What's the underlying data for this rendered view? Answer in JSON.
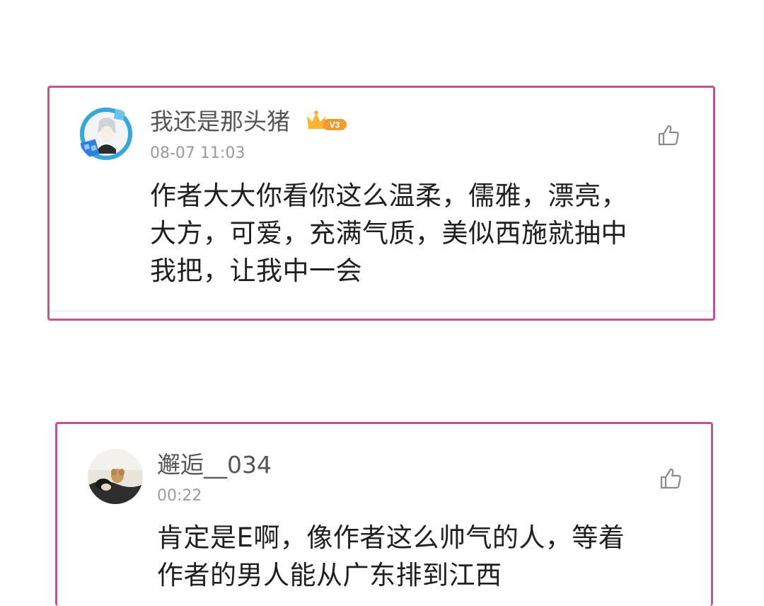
{
  "comments": [
    {
      "username": "我还是那头猪",
      "level_badge": "V3",
      "time": "08-07 11:03",
      "content_lines": [
        "作者大大你看你这么温柔，儒雅，漂亮，",
        "大方，可爱，充满气质，美似西施就抽中",
        "我把，让我中一会"
      ],
      "avatar_icon": "anime-character-avatar-icon",
      "like_icon": "thumbs-up-icon"
    },
    {
      "username": "邂逅__034",
      "time": "00:22",
      "content_lines": [
        "肯定是E啊，像作者这么帅气的人，等着",
        "作者的男人能从广东排到江西"
      ],
      "avatar_icon": "photo-avatar-icon",
      "like_icon": "thumbs-up-icon"
    }
  ],
  "colors": {
    "highlight_border": "#c0548f",
    "username": "#555555",
    "timestamp": "#9a9a9a",
    "content": "#1f1f1f",
    "badge": "#f29a2e"
  }
}
